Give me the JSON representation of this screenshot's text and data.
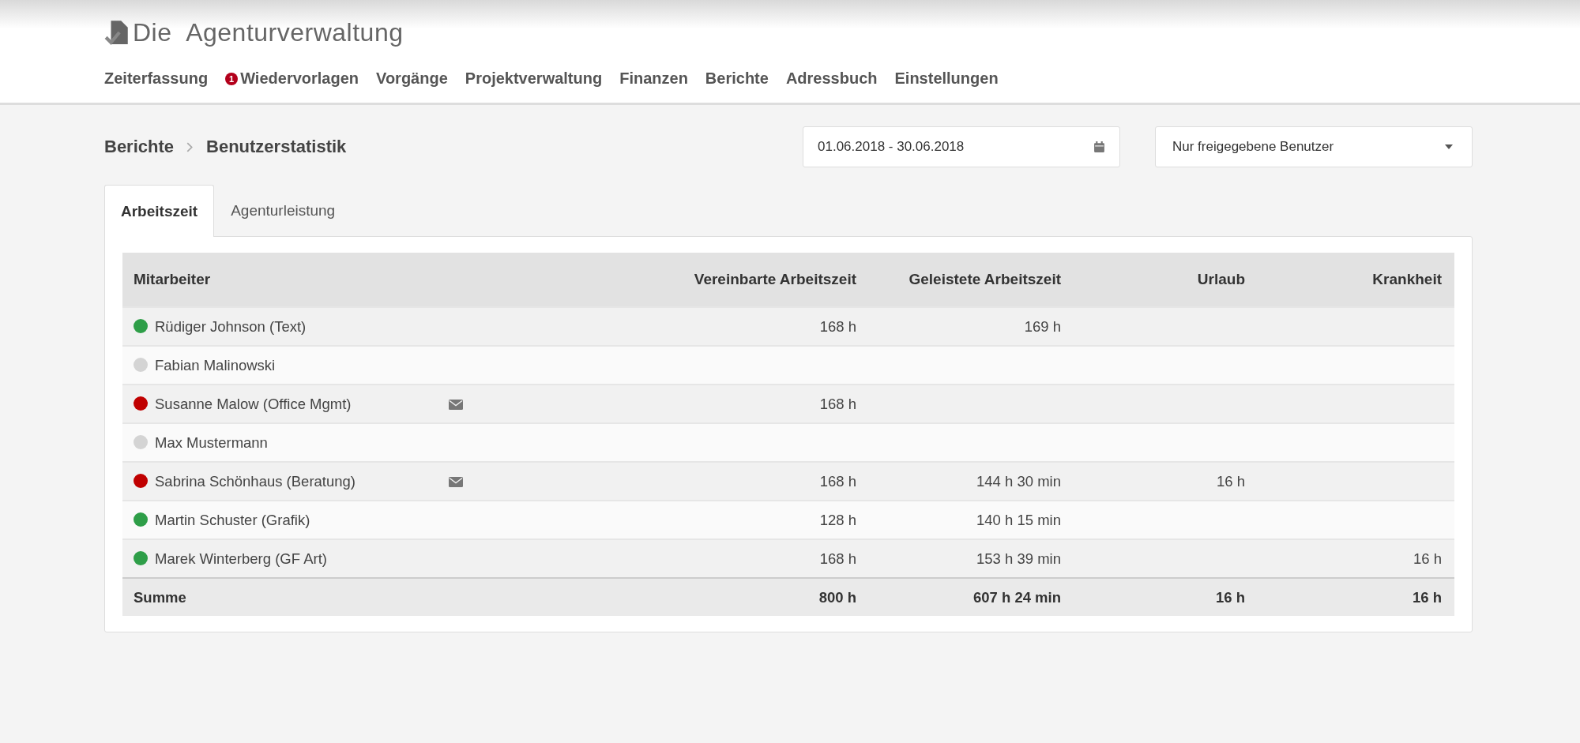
{
  "app": {
    "title": "Die Agenturverwaltung"
  },
  "nav": [
    {
      "label": "Zeiterfassung"
    },
    {
      "label": "Wiedervorlagen",
      "badge": "1"
    },
    {
      "label": "Vorgänge"
    },
    {
      "label": "Projektverwaltung"
    },
    {
      "label": "Finanzen"
    },
    {
      "label": "Berichte"
    },
    {
      "label": "Adressbuch"
    },
    {
      "label": "Einstellungen"
    }
  ],
  "breadcrumb": [
    "Berichte",
    "Benutzerstatistik"
  ],
  "date_range": {
    "value": "01.06.2018 - 30.06.2018"
  },
  "user_filter": {
    "value": "Nur freigegebene Benutzer"
  },
  "tabs": [
    {
      "label": "Arbeitszeit",
      "selected": true
    },
    {
      "label": "Agenturleistung",
      "selected": false
    }
  ],
  "table": {
    "columns": [
      "Mitarbeiter",
      "Vereinbarte Arbeitszeit",
      "Geleistete Arbeitszeit",
      "Urlaub",
      "Krankheit"
    ],
    "rows": [
      {
        "color": "#2e9e48",
        "mail": false,
        "cells": [
          "Rüdiger Johnson (Text)",
          "168 h",
          "169 h",
          "",
          ""
        ]
      },
      {
        "color": "#d4d4d4",
        "mail": false,
        "cells": [
          "Fabian Malinowski",
          "",
          "",
          "",
          ""
        ]
      },
      {
        "color": "#c00000",
        "mail": true,
        "cells": [
          "Susanne Malow (Office Mgmt)",
          "168 h",
          "",
          "",
          ""
        ]
      },
      {
        "color": "#d4d4d4",
        "mail": false,
        "cells": [
          "Max Mustermann",
          "",
          "",
          "",
          ""
        ]
      },
      {
        "color": "#c00000",
        "mail": true,
        "cells": [
          "Sabrina Schönhaus (Beratung)",
          "168 h",
          "144 h 30 min",
          "16 h",
          ""
        ]
      },
      {
        "color": "#2e9e48",
        "mail": false,
        "cells": [
          "Martin Schuster (Grafik)",
          "128 h",
          "140 h 15 min",
          "",
          ""
        ]
      },
      {
        "color": "#2e9e48",
        "mail": false,
        "cells": [
          "Marek Winterberg (GF Art)",
          "168 h",
          "153 h 39 min",
          "",
          "16 h"
        ]
      }
    ],
    "total": [
      "Summe",
      "800 h",
      "607 h 24 min",
      "16 h",
      "16 h"
    ]
  }
}
